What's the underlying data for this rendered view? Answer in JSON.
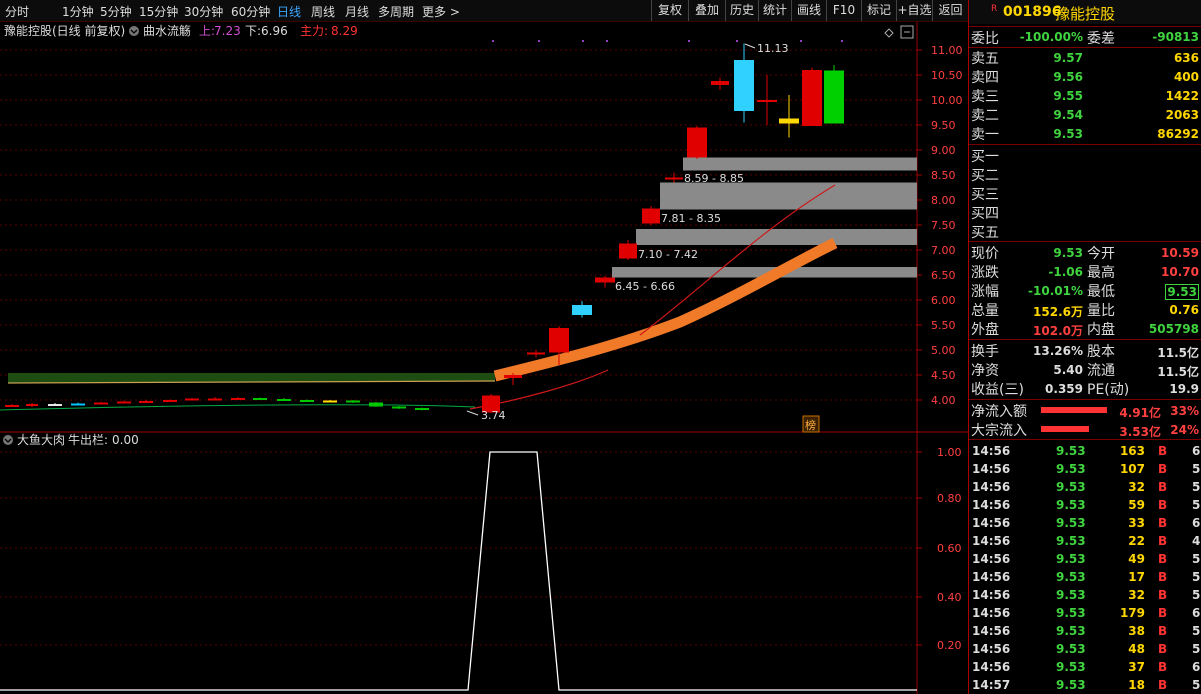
{
  "toolbar": {
    "periods": [
      "分时",
      "1分钟",
      "5分钟",
      "15分钟",
      "30分钟",
      "60分钟",
      "日线",
      "周线",
      "月线",
      "多周期",
      "更多 >"
    ],
    "active_period": "日线",
    "buttons": [
      "复权",
      "叠加",
      "历史",
      "统计",
      "画线",
      "F10",
      "标记",
      "+自选",
      "返回"
    ]
  },
  "chart_header": {
    "name": "豫能控股(日线 前复权)",
    "indicator": "曲水流觞",
    "up_label": "上:",
    "up_value": "7.23",
    "down_label": "下:",
    "down_value": "6.96",
    "main_label": "主力:",
    "main_value": "8.29"
  },
  "sub_header": {
    "name": "大鱼大肉",
    "field": "牛出栏:",
    "value": "0.00"
  },
  "badge": "榜",
  "annotations": {
    "high": "11.13",
    "low": "3.74",
    "zones": [
      "8.59 - 8.85",
      "7.81 - 8.35",
      "7.10 - 7.42",
      "6.45 - 6.66"
    ]
  },
  "price_axis": [
    "11.00",
    "10.50",
    "10.00",
    "9.50",
    "9.00",
    "8.50",
    "8.00",
    "7.50",
    "7.00",
    "6.50",
    "6.00",
    "5.50",
    "5.00",
    "4.50",
    "4.00"
  ],
  "sub_axis": [
    "1.00",
    "0.80",
    "0.60",
    "0.40",
    "0.20"
  ],
  "colors": {
    "up": "#e00000",
    "down": "#00c800",
    "accent_blue": "#39a7ff",
    "band_orange": "#f07a28"
  },
  "chart_data": {
    "type": "candlestick",
    "ylim": [
      3.6,
      11.4
    ],
    "candles": [
      {
        "o": 3.88,
        "c": 3.9,
        "h": 3.92,
        "l": 3.86
      },
      {
        "o": 3.88,
        "c": 3.92,
        "h": 3.94,
        "l": 3.86
      },
      {
        "o": 3.92,
        "c": 3.9,
        "h": 3.94,
        "l": 3.88
      },
      {
        "o": 3.91,
        "c": 3.93,
        "h": 3.95,
        "l": 3.89
      },
      {
        "o": 3.95,
        "c": 3.93,
        "h": 3.96,
        "l": 3.92
      },
      {
        "o": 3.97,
        "c": 3.95,
        "h": 3.99,
        "l": 3.94
      },
      {
        "o": 3.95,
        "c": 3.98,
        "h": 4.0,
        "l": 3.94
      },
      {
        "o": 3.98,
        "c": 4.0,
        "h": 4.01,
        "l": 3.96
      },
      {
        "o": 4.0,
        "c": 4.03,
        "h": 4.04,
        "l": 3.99
      },
      {
        "o": 4.03,
        "c": 4.02,
        "h": 4.06,
        "l": 4.0
      },
      {
        "o": 4.02,
        "c": 4.04,
        "h": 4.06,
        "l": 4.0
      },
      {
        "o": 4.04,
        "c": 4.03,
        "h": 4.05,
        "l": 4.01
      },
      {
        "o": 4.02,
        "c": 4.0,
        "h": 4.04,
        "l": 3.98
      },
      {
        "o": 4.0,
        "c": 3.98,
        "h": 4.01,
        "l": 3.96
      },
      {
        "o": 3.98,
        "c": 3.99,
        "h": 4.0,
        "l": 3.96
      },
      {
        "o": 3.99,
        "c": 3.95,
        "h": 4.0,
        "l": 3.94
      },
      {
        "o": 3.95,
        "c": 3.87,
        "h": 3.96,
        "l": 3.86
      },
      {
        "o": 3.87,
        "c": 3.84,
        "h": 3.88,
        "l": 3.82
      },
      {
        "o": 3.84,
        "c": 3.8,
        "h": 3.85,
        "l": 3.79
      },
      {
        "o": 3.75,
        "c": 4.09,
        "h": 4.12,
        "l": 3.74
      },
      {
        "o": 4.44,
        "c": 4.5,
        "h": 4.54,
        "l": 4.3
      },
      {
        "o": 4.95,
        "c": 4.95,
        "h": 5.0,
        "l": 4.85
      },
      {
        "o": 4.95,
        "c": 5.44,
        "h": 5.48,
        "l": 4.7
      },
      {
        "o": 5.9,
        "c": 5.7,
        "h": 5.98,
        "l": 5.65
      },
      {
        "o": 6.45,
        "c": 6.35,
        "h": 6.48,
        "l": 6.25
      },
      {
        "o": 6.83,
        "c": 7.13,
        "h": 7.2,
        "l": 6.8
      },
      {
        "o": 7.53,
        "c": 7.83,
        "h": 7.88,
        "l": 7.5
      },
      {
        "o": 8.45,
        "c": 8.45,
        "h": 8.55,
        "l": 8.35
      },
      {
        "o": 8.85,
        "c": 9.45,
        "h": 9.48,
        "l": 8.82
      },
      {
        "o": 10.3,
        "c": 10.38,
        "h": 10.45,
        "l": 10.2
      },
      {
        "o": 10.8,
        "c": 9.78,
        "h": 11.13,
        "l": 9.55
      },
      {
        "o": 10.0,
        "c": 10.0,
        "h": 10.5,
        "l": 9.5
      },
      {
        "o": 9.63,
        "c": 9.53,
        "h": 10.1,
        "l": 9.25
      },
      {
        "o": 9.48,
        "c": 10.6,
        "h": 10.65,
        "l": 9.48
      },
      {
        "o": 10.59,
        "c": 9.53,
        "h": 10.7,
        "l": 9.53
      }
    ],
    "sub_series": {
      "name": "牛出栏",
      "x": [
        468,
        490,
        537,
        559
      ],
      "values": [
        0,
        1,
        1,
        0
      ]
    }
  },
  "quote": {
    "code": "001896",
    "name": "豫能控股",
    "webi_label": "委比",
    "webi_value": "-100.00%",
    "weicha_label": "委差",
    "weicha_value": "-90813",
    "asks": [
      {
        "label": "卖五",
        "price": "9.57",
        "vol": "636"
      },
      {
        "label": "卖四",
        "price": "9.56",
        "vol": "400"
      },
      {
        "label": "卖三",
        "price": "9.55",
        "vol": "1422"
      },
      {
        "label": "卖二",
        "price": "9.54",
        "vol": "2063"
      },
      {
        "label": "卖一",
        "price": "9.53",
        "vol": "86292"
      }
    ],
    "bids": [
      "买一",
      "买二",
      "买三",
      "买四",
      "买五"
    ],
    "stats": [
      {
        "l1": "现价",
        "v1": "9.53",
        "c1": "green",
        "l2": "今开",
        "v2": "10.59",
        "c2": "red"
      },
      {
        "l1": "涨跌",
        "v1": "-1.06",
        "c1": "green",
        "l2": "最高",
        "v2": "10.70",
        "c2": "red"
      },
      {
        "l1": "涨幅",
        "v1": "-10.01%",
        "c1": "green",
        "l2": "最低",
        "v2": "9.53",
        "c2": "greenbox"
      },
      {
        "l1": "总量",
        "v1": "152.6万",
        "c1": "yellow",
        "l2": "量比",
        "v2": "0.76",
        "c2": "yellow"
      },
      {
        "l1": "外盘",
        "v1": "102.0万",
        "c1": "red",
        "l2": "内盘",
        "v2": "505798",
        "c2": "green"
      }
    ],
    "stats2": [
      {
        "l1": "换手",
        "v1": "13.26%",
        "l2": "股本",
        "v2": "11.5亿"
      },
      {
        "l1": "净资",
        "v1": "5.40",
        "l2": "流通",
        "v2": "11.5亿"
      },
      {
        "l1": "收益(三)",
        "v1": "0.359",
        "l2": "PE(动)",
        "v2": "19.9"
      }
    ],
    "flows": [
      {
        "label": "净流入额",
        "value": "4.91亿",
        "pct": "33%",
        "bar": 0.33
      },
      {
        "label": "大宗流入",
        "value": "3.53亿",
        "pct": "24%",
        "bar": 0.24
      }
    ]
  },
  "ticks": [
    {
      "t": "14:56",
      "p": "9.53",
      "v": "163",
      "s": "B",
      "n": "6"
    },
    {
      "t": "14:56",
      "p": "9.53",
      "v": "107",
      "s": "B",
      "n": "5"
    },
    {
      "t": "14:56",
      "p": "9.53",
      "v": "32",
      "s": "B",
      "n": "5"
    },
    {
      "t": "14:56",
      "p": "9.53",
      "v": "59",
      "s": "B",
      "n": "5"
    },
    {
      "t": "14:56",
      "p": "9.53",
      "v": "33",
      "s": "B",
      "n": "6"
    },
    {
      "t": "14:56",
      "p": "9.53",
      "v": "22",
      "s": "B",
      "n": "4"
    },
    {
      "t": "14:56",
      "p": "9.53",
      "v": "49",
      "s": "B",
      "n": "5"
    },
    {
      "t": "14:56",
      "p": "9.53",
      "v": "17",
      "s": "B",
      "n": "5"
    },
    {
      "t": "14:56",
      "p": "9.53",
      "v": "32",
      "s": "B",
      "n": "5"
    },
    {
      "t": "14:56",
      "p": "9.53",
      "v": "179",
      "s": "B",
      "n": "6"
    },
    {
      "t": "14:56",
      "p": "9.53",
      "v": "38",
      "s": "B",
      "n": "5"
    },
    {
      "t": "14:56",
      "p": "9.53",
      "v": "48",
      "s": "B",
      "n": "5"
    },
    {
      "t": "14:56",
      "p": "9.53",
      "v": "37",
      "s": "B",
      "n": "6"
    },
    {
      "t": "14:57",
      "p": "9.53",
      "v": "18",
      "s": "B",
      "n": "5"
    }
  ]
}
